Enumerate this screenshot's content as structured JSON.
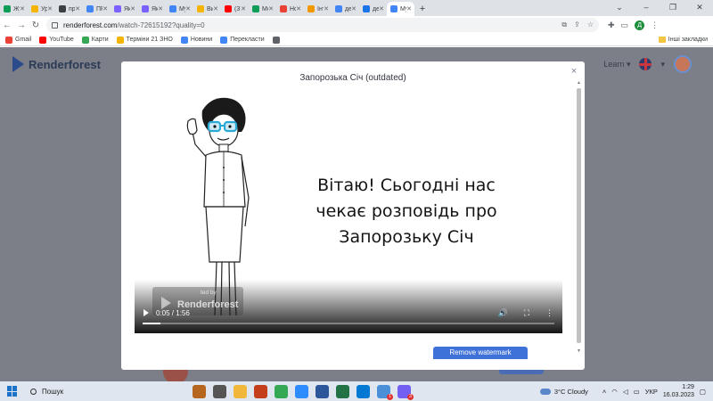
{
  "browser": {
    "tabs": [
      {
        "title": "Жу",
        "color": "#0f9d58",
        "active": false
      },
      {
        "title": "Ур",
        "color": "#f4b400",
        "active": false
      },
      {
        "title": "пр",
        "color": "#3c4043",
        "active": false
      },
      {
        "title": "ПР",
        "color": "#4285f4",
        "active": false
      },
      {
        "title": "Як",
        "color": "#7b61ff",
        "active": false
      },
      {
        "title": "Як",
        "color": "#7b61ff",
        "active": false
      },
      {
        "title": "Му",
        "color": "#4285f4",
        "active": false
      },
      {
        "title": "Ви",
        "color": "#f4b400",
        "active": false
      },
      {
        "title": "(37",
        "color": "#ff0000",
        "active": false
      },
      {
        "title": "Мо",
        "color": "#0f9d58",
        "active": false
      },
      {
        "title": "Но",
        "color": "#e94235",
        "active": false
      },
      {
        "title": "Інт",
        "color": "#f29900",
        "active": false
      },
      {
        "title": "дер",
        "color": "#4285f4",
        "active": false
      },
      {
        "title": "дер",
        "color": "#1a73e8",
        "active": false
      },
      {
        "title": "Му",
        "color": "#4285f4",
        "active": true
      }
    ],
    "new_tab": "+",
    "window_controls": {
      "chevron": "⌄",
      "minimize": "–",
      "restore": "❐",
      "close": "✕"
    },
    "address": {
      "host": "renderforest.com",
      "path": "/watch-72615192?quality=0"
    },
    "bookmarks": [
      {
        "label": "Gmail",
        "color": "#ea4335"
      },
      {
        "label": "YouTube",
        "color": "#ff0000"
      },
      {
        "label": "Карти",
        "color": "#34a853"
      },
      {
        "label": "Терміни 21 ЗНО",
        "color": "#f4b400"
      },
      {
        "label": "Новини",
        "color": "#4285f4"
      },
      {
        "label": "Перекласти",
        "color": "#4285f4"
      },
      {
        "label": "",
        "color": "#5f6368"
      }
    ],
    "other_bookmarks": "Інші закладки",
    "profile_initial": "Д"
  },
  "site": {
    "brand": "Renderforest",
    "learn": "Learn ▾",
    "lang_caret": "▾"
  },
  "modal": {
    "title": "Запорозька Січ (outdated)",
    "close": "×",
    "video": {
      "caption": "Вітаю! Сьогодні нас чекає розповідь про Запорозьку Січ",
      "watermark_by": "ted by",
      "watermark_name": "Renderforest",
      "time": "0:05 / 1:56",
      "progress": 0.043,
      "volume_icon": "🔊",
      "fullscreen_icon": "⛶",
      "more_icon": "⋮"
    },
    "remove_watermark": "Remove watermark"
  },
  "taskbar": {
    "search": "Пошук",
    "apps": [
      {
        "name": "landscape",
        "color": "#b5651d"
      },
      {
        "name": "taskview",
        "color": "#555"
      },
      {
        "name": "explorer",
        "color": "#f1b73b"
      },
      {
        "name": "powerpoint",
        "color": "#c43e1c"
      },
      {
        "name": "chrome",
        "color": "#34a853"
      },
      {
        "name": "zoom",
        "color": "#2d8cff"
      },
      {
        "name": "word",
        "color": "#2b579a"
      },
      {
        "name": "excel",
        "color": "#217346"
      },
      {
        "name": "photos",
        "color": "#0078d4"
      },
      {
        "name": "telegram-like",
        "color": "#4a90d9",
        "badge": "1"
      },
      {
        "name": "viber",
        "color": "#7360f2",
        "badge": "3"
      }
    ],
    "weather": "3°C  Cloudy",
    "lang": "УКР",
    "time": "1:29",
    "date": "16.03.2023"
  }
}
